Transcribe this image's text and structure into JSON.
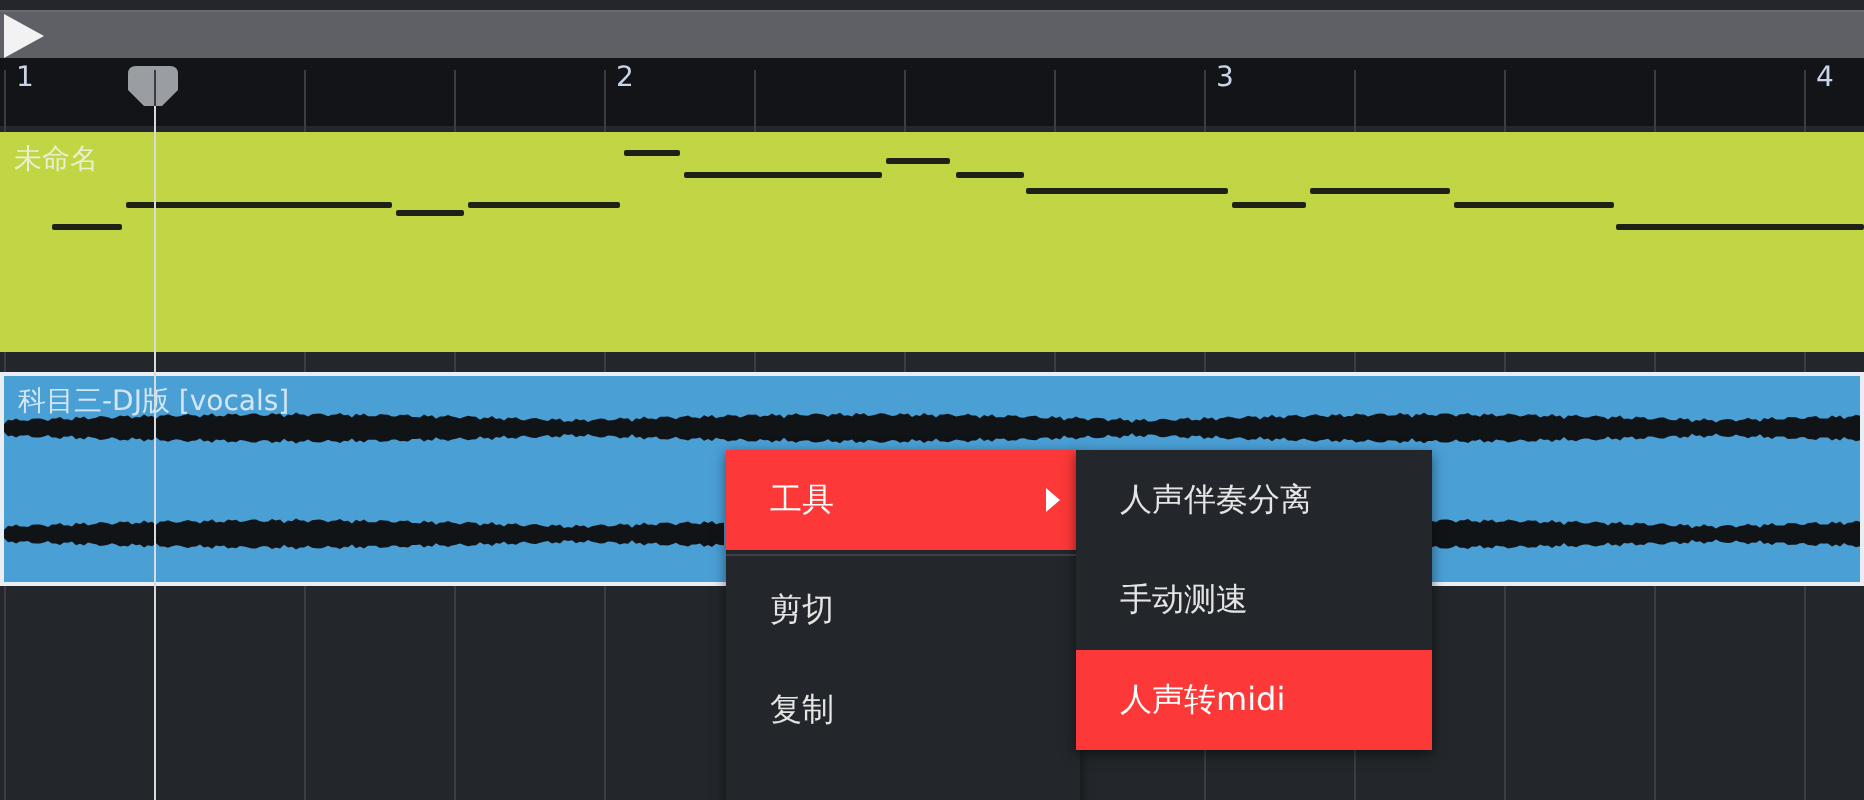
{
  "ruler": {
    "markers": [
      "1",
      "2",
      "3",
      "4"
    ]
  },
  "tracks": [
    {
      "kind": "midi",
      "name": "未命名",
      "color": "#c2d544",
      "selected": false
    },
    {
      "kind": "audio",
      "name": "科目三-DJ版 [vocals]",
      "color": "#4a9fd5",
      "selected": true
    }
  ],
  "context_menu": {
    "items": [
      {
        "label": "工具",
        "selected": true,
        "has_submenu": true
      },
      {
        "label": "剪切",
        "selected": false,
        "has_submenu": false
      },
      {
        "label": "复制",
        "selected": false,
        "has_submenu": false
      }
    ],
    "submenu": [
      {
        "label": "人声伴奏分离",
        "selected": false
      },
      {
        "label": "手动测速",
        "selected": false
      },
      {
        "label": "人声转midi",
        "selected": true
      }
    ]
  }
}
